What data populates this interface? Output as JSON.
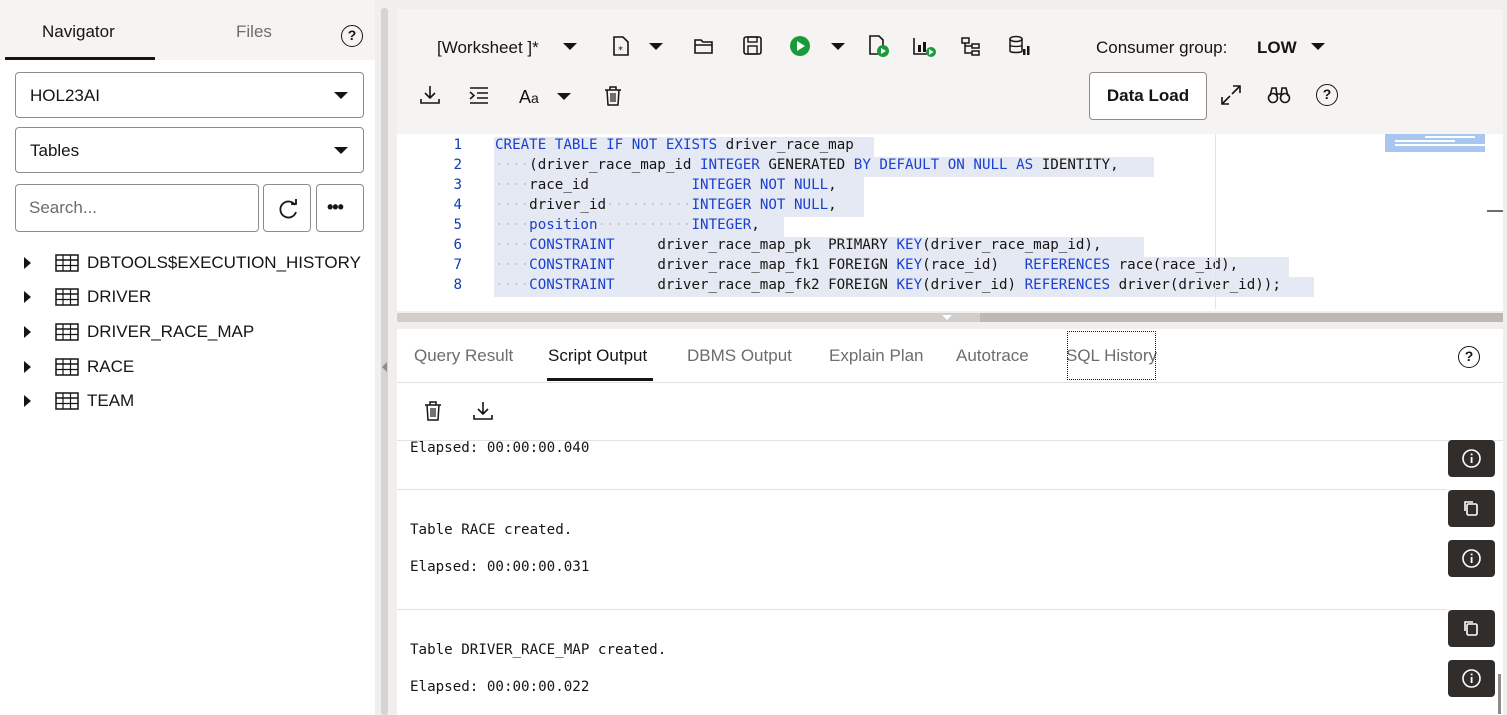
{
  "left_panel": {
    "tabs": [
      {
        "label": "Navigator"
      },
      {
        "label": "Files"
      }
    ],
    "help": "?",
    "schema_select": "HOL23AI",
    "object_type_select": "Tables",
    "search": {
      "placeholder": "Search...",
      "value": ""
    },
    "more_label": "•••",
    "tree_items": [
      {
        "label": "DBTOOLS$EXECUTION_HISTORY"
      },
      {
        "label": "DRIVER"
      },
      {
        "label": "DRIVER_RACE_MAP"
      },
      {
        "label": "RACE"
      },
      {
        "label": "TEAM"
      }
    ]
  },
  "toolbar": {
    "worksheet_label": "[Worksheet ]*",
    "consumer_group_label": "Consumer group:",
    "consumer_group_value": "LOW",
    "data_load_label": "Data Load",
    "help": "?"
  },
  "editor": {
    "lines": [
      {
        "n": "1",
        "html": "<span class=\"kw\">CREATE</span> <span class=\"kw\">TABLE</span> <span class=\"kw\">IF</span> <span class=\"kw\">NOT</span> <span class=\"kw\">EXISTS</span> driver_race_map "
      },
      {
        "n": "2",
        "html": "<span class=\"ind\">····</span>(driver_race_map_id <span class=\"kw\">INTEGER</span> GENERATED <span class=\"kw\">BY</span> <span class=\"kw\">DEFAULT</span> <span class=\"kw\">ON</span> <span class=\"kw\">NULL</span> <span class=\"kw\">AS</span> IDENTITY,"
      },
      {
        "n": "3",
        "html": "<span class=\"ind\">····</span>race_id<span class=\"ind\">            </span><span class=\"kw\">INTEGER</span> <span class=\"kw\">NOT</span> <span class=\"kw\">NULL</span>,"
      },
      {
        "n": "4",
        "html": "<span class=\"ind\">····</span>driver_id<span class=\"ind\">··········</span><span class=\"kw\">INTEGER</span> <span class=\"kw\">NOT</span> <span class=\"kw\">NULL</span>,"
      },
      {
        "n": "5",
        "html": "<span class=\"ind\">····</span><span class=\"kw\">position</span><span class=\"ind\">···········</span><span class=\"kw\">INTEGER</span>,"
      },
      {
        "n": "6",
        "html": "<span class=\"ind\">····</span><span class=\"kw\">CONSTRAINT</span><span class=\"ind\">     </span>driver_race_map_pk  PRIMARY <span class=\"kw\">KEY</span>(driver_race_map_id),"
      },
      {
        "n": "7",
        "html": "<span class=\"ind\">····</span><span class=\"kw\">CONSTRAINT</span><span class=\"ind\">     </span>driver_race_map_fk1 FOREIGN <span class=\"kw\">KEY</span>(race_id)   <span class=\"kw\">REFERENCES</span> race(race_id),"
      },
      {
        "n": "8",
        "html": "<span class=\"ind\">····</span><span class=\"kw\">CONSTRAINT</span><span class=\"ind\">     </span>driver_race_map_fk2 FOREIGN <span class=\"kw\">KEY</span>(driver_id) <span class=\"kw\">REFERENCES</span> driver(driver_id));"
      }
    ]
  },
  "output_tabs": [
    {
      "label": "Query Result"
    },
    {
      "label": "Script Output"
    },
    {
      "label": "DBMS Output"
    },
    {
      "label": "Explain Plan"
    },
    {
      "label": "Autotrace"
    },
    {
      "label": "SQL History"
    }
  ],
  "output_help": "?",
  "output": [
    {
      "text": "Elapsed: 00:00:00.040"
    },
    {
      "text": "Table RACE created."
    },
    {
      "text": "Elapsed: 00:00:00.031"
    },
    {
      "text": "Table DRIVER_RACE_MAP created."
    },
    {
      "text": "Elapsed: 00:00:00.022"
    }
  ]
}
